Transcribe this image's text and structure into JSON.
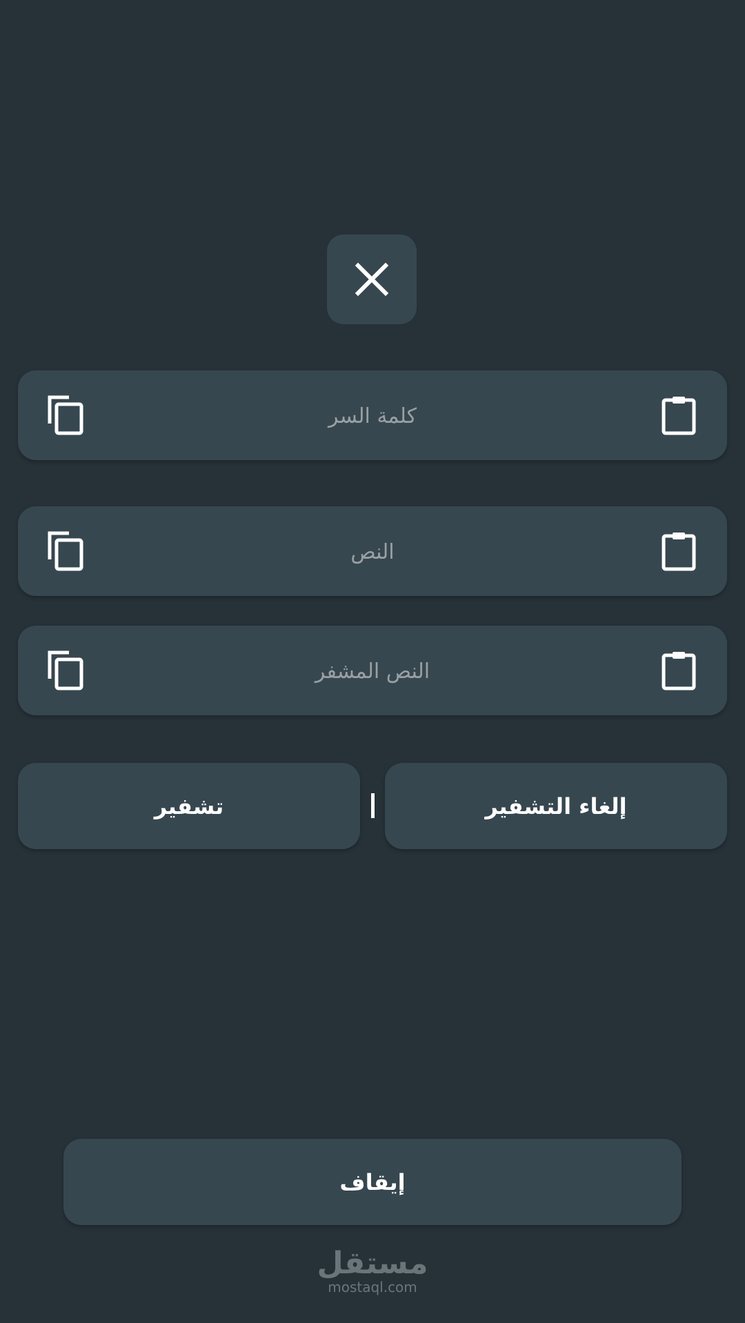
{
  "fields": [
    {
      "placeholder": "كلمة السر",
      "value": ""
    },
    {
      "placeholder": "النص",
      "value": ""
    },
    {
      "placeholder": "النص المشفر",
      "value": ""
    }
  ],
  "actions": {
    "encrypt_label": "تشفير",
    "decrypt_label": "إلغاء التشفير",
    "divider": "|"
  },
  "stop_label": "إيقاف",
  "icons": {
    "close": "close-icon",
    "copy": "copy-icon",
    "paste": "clipboard-icon"
  },
  "watermark": {
    "arabic": "مستقل",
    "latin": "mostaql.com"
  },
  "colors": {
    "background": "#263238",
    "surface": "#37474f",
    "text": "#ffffff",
    "placeholder": "#9aa0a3"
  }
}
